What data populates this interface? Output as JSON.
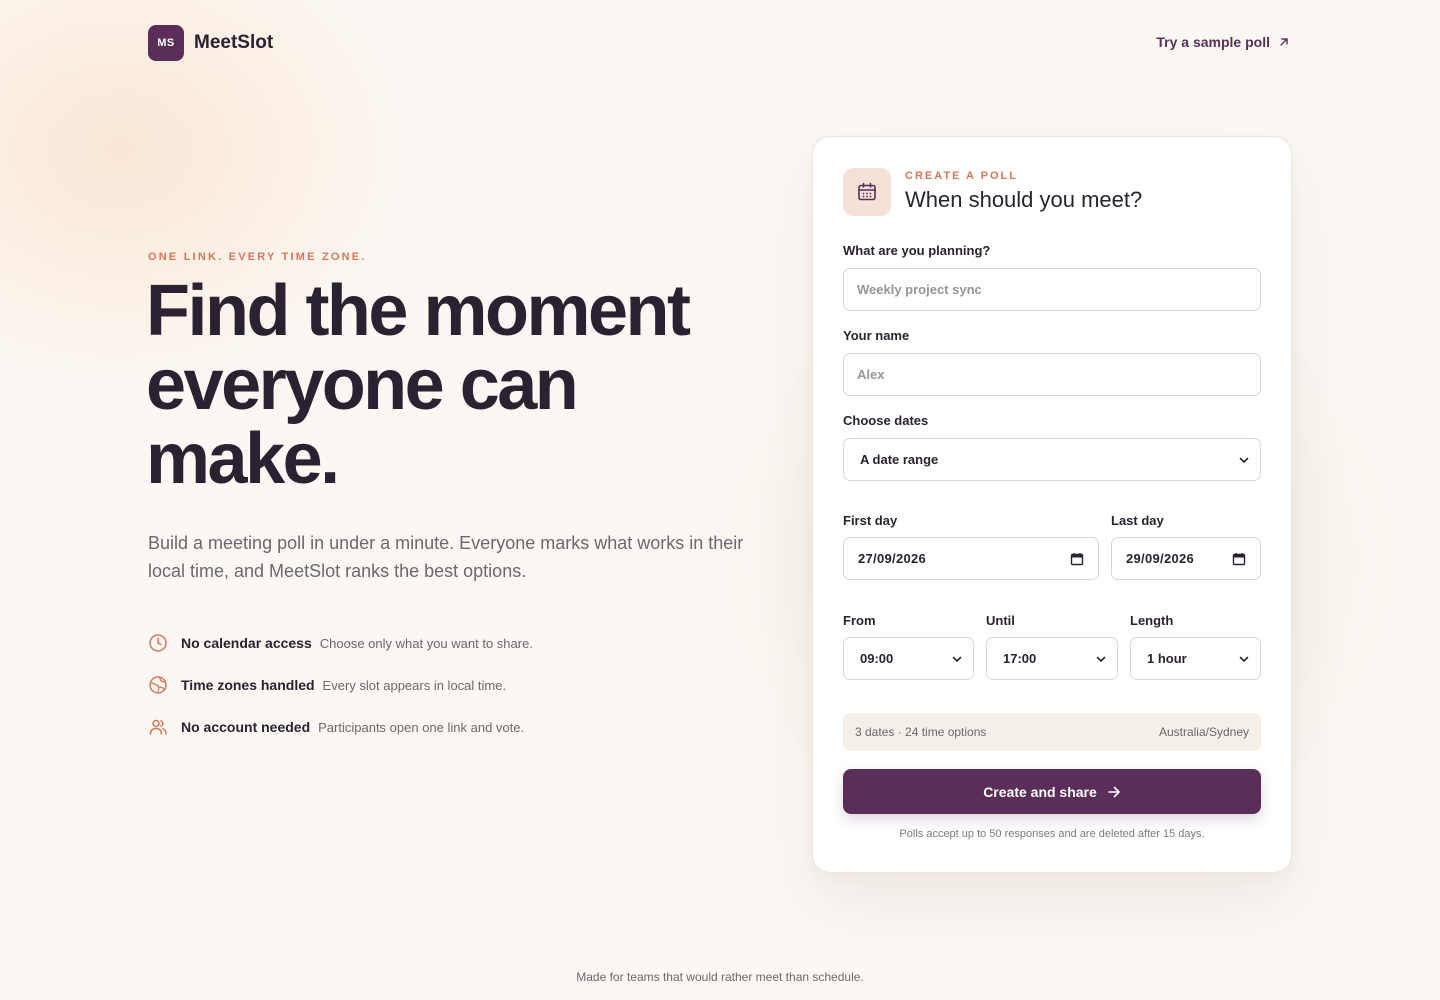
{
  "brand": {
    "mark": "MS",
    "name": "MeetSlot"
  },
  "header": {
    "sample_link": "Try a sample poll"
  },
  "hero": {
    "eyebrow": "ONE LINK. EVERY TIME ZONE.",
    "title_line1": "Find the moment",
    "title_line2": "everyone can",
    "title_line3": "make.",
    "subtitle": "Build a meeting poll in under a minute. Everyone marks what works in their local time, and MeetSlot ranks the best options."
  },
  "features": [
    {
      "icon": "clock-icon",
      "title": "No calendar access",
      "desc": "Choose only what you want to share."
    },
    {
      "icon": "globe-icon",
      "title": "Time zones handled",
      "desc": "Every slot appears in local time."
    },
    {
      "icon": "users-icon",
      "title": "No account needed",
      "desc": "Participants open one link and vote."
    }
  ],
  "form": {
    "eyebrow": "CREATE A POLL",
    "title": "When should you meet?",
    "planning_label": "What are you planning?",
    "planning_placeholder": "Weekly project sync",
    "name_label": "Your name",
    "name_placeholder": "Alex",
    "dates_label": "Choose dates",
    "dates_value": "A date range",
    "first_day_label": "First day",
    "first_day_value": "27/09/2026",
    "last_day_label": "Last day",
    "last_day_value": "29/09/2026",
    "from_label": "From",
    "from_value": "09:00",
    "until_label": "Until",
    "until_value": "17:00",
    "length_label": "Length",
    "length_value": "1 hour",
    "summary_left": "3 dates · 24 time options",
    "summary_right": "Australia/Sydney",
    "submit_label": "Create and share",
    "note": "Polls accept up to 50 responses and are deleted after 15 days."
  },
  "footer": {
    "text": "Made for teams that would rather meet than schedule."
  },
  "colors": {
    "brand": "#5b2e59",
    "accent": "#d8765a",
    "background": "#fbf7f2",
    "text": "#2a2230",
    "muted": "#6e6670"
  }
}
